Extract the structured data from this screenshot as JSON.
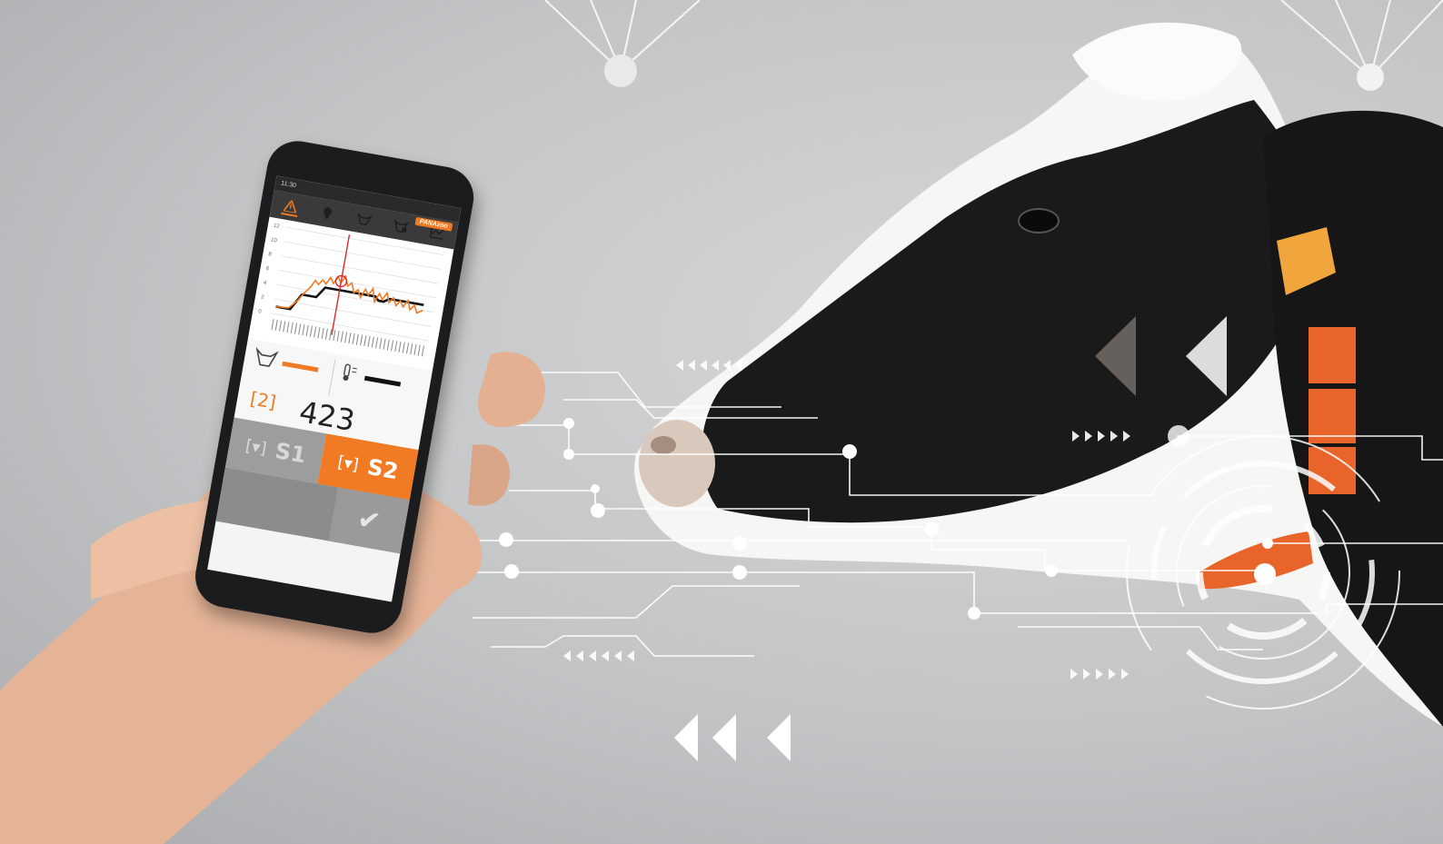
{
  "app": {
    "status_time": "11:30",
    "brand": "PANAzoo",
    "toolbar_icons": [
      "warning-icon",
      "bulb-icon",
      "cow-icon",
      "cow-health-icon",
      "chart-icon"
    ]
  },
  "chart": {
    "y_ticks": [
      "12",
      "10",
      "8",
      "6",
      "4",
      "2",
      "0"
    ],
    "x_tick_count": 40
  },
  "info": {
    "selection_label": "[2]",
    "count": "423"
  },
  "buttons": {
    "s1_icon": "[▾]",
    "s1_label": "S1",
    "s2_icon": "[▾]",
    "s2_label": "S2",
    "confirm_glyph": "✔"
  },
  "colors": {
    "accent": "#f07b24",
    "background": "#c4c6c8"
  }
}
